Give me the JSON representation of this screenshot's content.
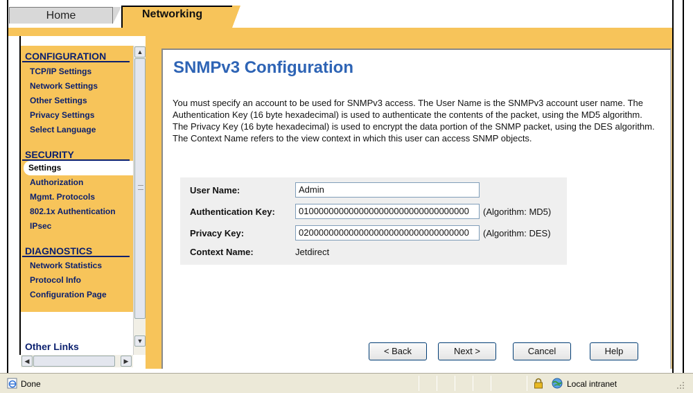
{
  "tabs": [
    {
      "label": "Home",
      "active": false
    },
    {
      "label": "Networking",
      "active": true
    }
  ],
  "sidebar": {
    "sections": [
      {
        "title": "CONFIGURATION",
        "items": [
          "TCP/IP Settings",
          "Network Settings",
          "Other Settings",
          "Privacy Settings",
          "Select Language"
        ]
      },
      {
        "title": "SECURITY",
        "items": [
          "Settings",
          "Authorization",
          "Mgmt. Protocols",
          "802.1x Authentication",
          "IPsec"
        ]
      },
      {
        "title": "DIAGNOSTICS",
        "items": [
          "Network Statistics",
          "Protocol Info",
          "Configuration Page"
        ]
      }
    ],
    "active_item": "Settings",
    "other_links": "Other Links"
  },
  "main": {
    "title": "SNMPv3 Configuration",
    "intro": "You must specify an account to be used for SNMPv3 access. The User Name is the SNMPv3 account user name. The Authentication Key (16 byte hexadecimal) is used to authenticate the contents of the packet, using the MD5 algorithm. The Privacy Key (16 byte hexadecimal) is used to encrypt the data portion of the SNMP packet, using the DES algorithm. The Context Name refers to the view context in which this user can access SNMP objects.",
    "form": {
      "user_name_label": "User Name:",
      "user_name_value": "Admin",
      "auth_key_label": "Authentication Key:",
      "auth_key_value": "0100000000000000000000000000000000",
      "auth_algorithm": "(Algorithm: MD5)",
      "privacy_key_label": "Privacy Key:",
      "privacy_key_value": "0200000000000000000000000000000000",
      "privacy_algorithm": "(Algorithm: DES)",
      "context_name_label": "Context Name:",
      "context_name_value": "Jetdirect"
    },
    "buttons": {
      "back": "< Back",
      "next": "Next >",
      "cancel": "Cancel",
      "help": "Help"
    }
  },
  "statusbar": {
    "status": "Done",
    "zone": "Local intranet"
  },
  "colors": {
    "accent_orange": "#f7c45a",
    "nav_blue": "#0a1f6e",
    "title_blue": "#2e64b5"
  }
}
